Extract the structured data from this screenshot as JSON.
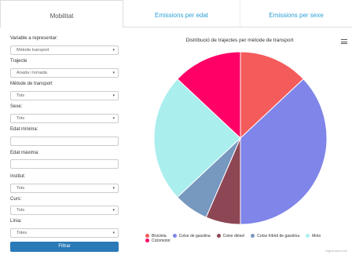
{
  "tabs": [
    {
      "label": "Mobilitat"
    },
    {
      "label": "Emissions per edat"
    },
    {
      "label": "Emissions per sexe"
    }
  ],
  "sidebar": {
    "variable_label": "Variable a representar:",
    "variable_value": "Mètode transport",
    "trajecte_label": "Trajecte",
    "trajecte_value": "Anada i tornada",
    "metode_label": "Mètode de transport",
    "metode_value": "Tots",
    "sexe_label": "Sexe:",
    "sexe_value": "Tots",
    "edat_min_label": "Edat mínima:",
    "edat_min_value": "",
    "edat_max_label": "Edat màxima:",
    "edat_max_value": "",
    "institut_label": "Institut:",
    "institut_value": "Tots",
    "curs_label": "Curs:",
    "curs_value": "Tots",
    "linia_label": "Línia:",
    "linia_value": "Totes",
    "filtrar_label": "Filtrar"
  },
  "chart_data": {
    "type": "pie",
    "title": "Distribució de trajectes per mètode de transport",
    "legend_placement": "bottom",
    "series": [
      {
        "name": "Bicicleta",
        "value": 13.0,
        "color": "#f45b5b"
      },
      {
        "name": "Cotxe de gasolina",
        "value": 37.0,
        "color": "#8085e9"
      },
      {
        "name": "Cotxe dièsel",
        "value": 6.5,
        "color": "#8d4654"
      },
      {
        "name": "Cotxe híbrid de gasolina",
        "value": 6.5,
        "color": "#7798bf"
      },
      {
        "name": "Moto",
        "value": 24.0,
        "color": "#aaeeee"
      },
      {
        "name": "Ciclomotor",
        "value": 13.0,
        "color": "#ff0066"
      }
    ]
  },
  "credit": "Highcharts.com"
}
